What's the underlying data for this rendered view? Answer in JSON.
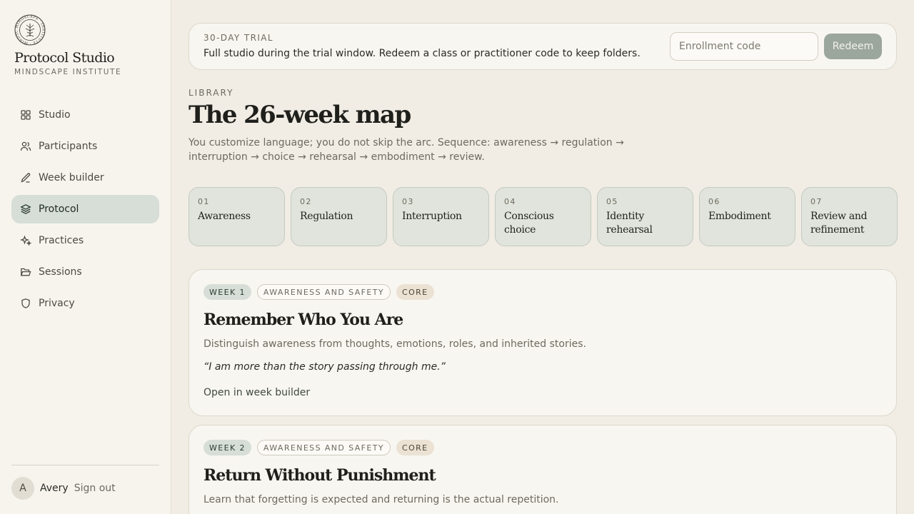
{
  "sidebar": {
    "logo_text": "MINDSCAPE INSTITUTE",
    "brand_title": "Protocol Studio",
    "brand_subtitle": "MINDSCAPE INSTITUTE",
    "items": [
      {
        "label": "Studio",
        "icon": "grid-icon",
        "active": false
      },
      {
        "label": "Participants",
        "icon": "users-icon",
        "active": false
      },
      {
        "label": "Week builder",
        "icon": "pencil-icon",
        "active": false
      },
      {
        "label": "Protocol",
        "icon": "layers-icon",
        "active": true
      },
      {
        "label": "Practices",
        "icon": "sparkle-icon",
        "active": false
      },
      {
        "label": "Sessions",
        "icon": "folder-open-icon",
        "active": false
      },
      {
        "label": "Privacy",
        "icon": "shield-icon",
        "active": false
      }
    ],
    "user": {
      "initial": "A",
      "name": "Avery",
      "sign_out": "Sign out"
    }
  },
  "trial": {
    "eyebrow": "30-DAY TRIAL",
    "text": "Full studio during the trial window. Redeem a class or practitioner code to keep folders.",
    "input_placeholder": "Enrollment code",
    "input_value": "",
    "button_label": "Redeem"
  },
  "page": {
    "eyebrow": "LIBRARY",
    "title": "The 26-week map",
    "description": "You customize language; you do not skip the arc. Sequence: awareness → regulation → interruption → choice → rehearsal → embodiment → review."
  },
  "phases": [
    {
      "num": "01",
      "name": "Awareness"
    },
    {
      "num": "02",
      "name": "Regulation"
    },
    {
      "num": "03",
      "name": "Interruption"
    },
    {
      "num": "04",
      "name": "Conscious choice"
    },
    {
      "num": "05",
      "name": "Identity rehearsal"
    },
    {
      "num": "06",
      "name": "Embodiment"
    },
    {
      "num": "07",
      "name": "Review and refinement"
    }
  ],
  "weeks": [
    {
      "week": "WEEK 1",
      "theme": "AWARENESS AND SAFETY",
      "tier": "CORE",
      "title": "Remember Who You Are",
      "description": "Distinguish awareness from thoughts, emotions, roles, and inherited stories.",
      "quote": "“I am more than the story passing through me.”",
      "link": "Open in week builder"
    },
    {
      "week": "WEEK 2",
      "theme": "AWARENESS AND SAFETY",
      "tier": "CORE",
      "title": "Return Without Punishment",
      "description": "Learn that forgetting is expected and returning is the actual repetition."
    }
  ],
  "colors": {
    "background": "#f1ede4",
    "sidebar": "#f7f4ee",
    "active_nav": "#d6ded7",
    "phase_card": "#e1e4dc",
    "redeem_button": "#9ba69d",
    "core_tag": "#ebe2d4"
  }
}
